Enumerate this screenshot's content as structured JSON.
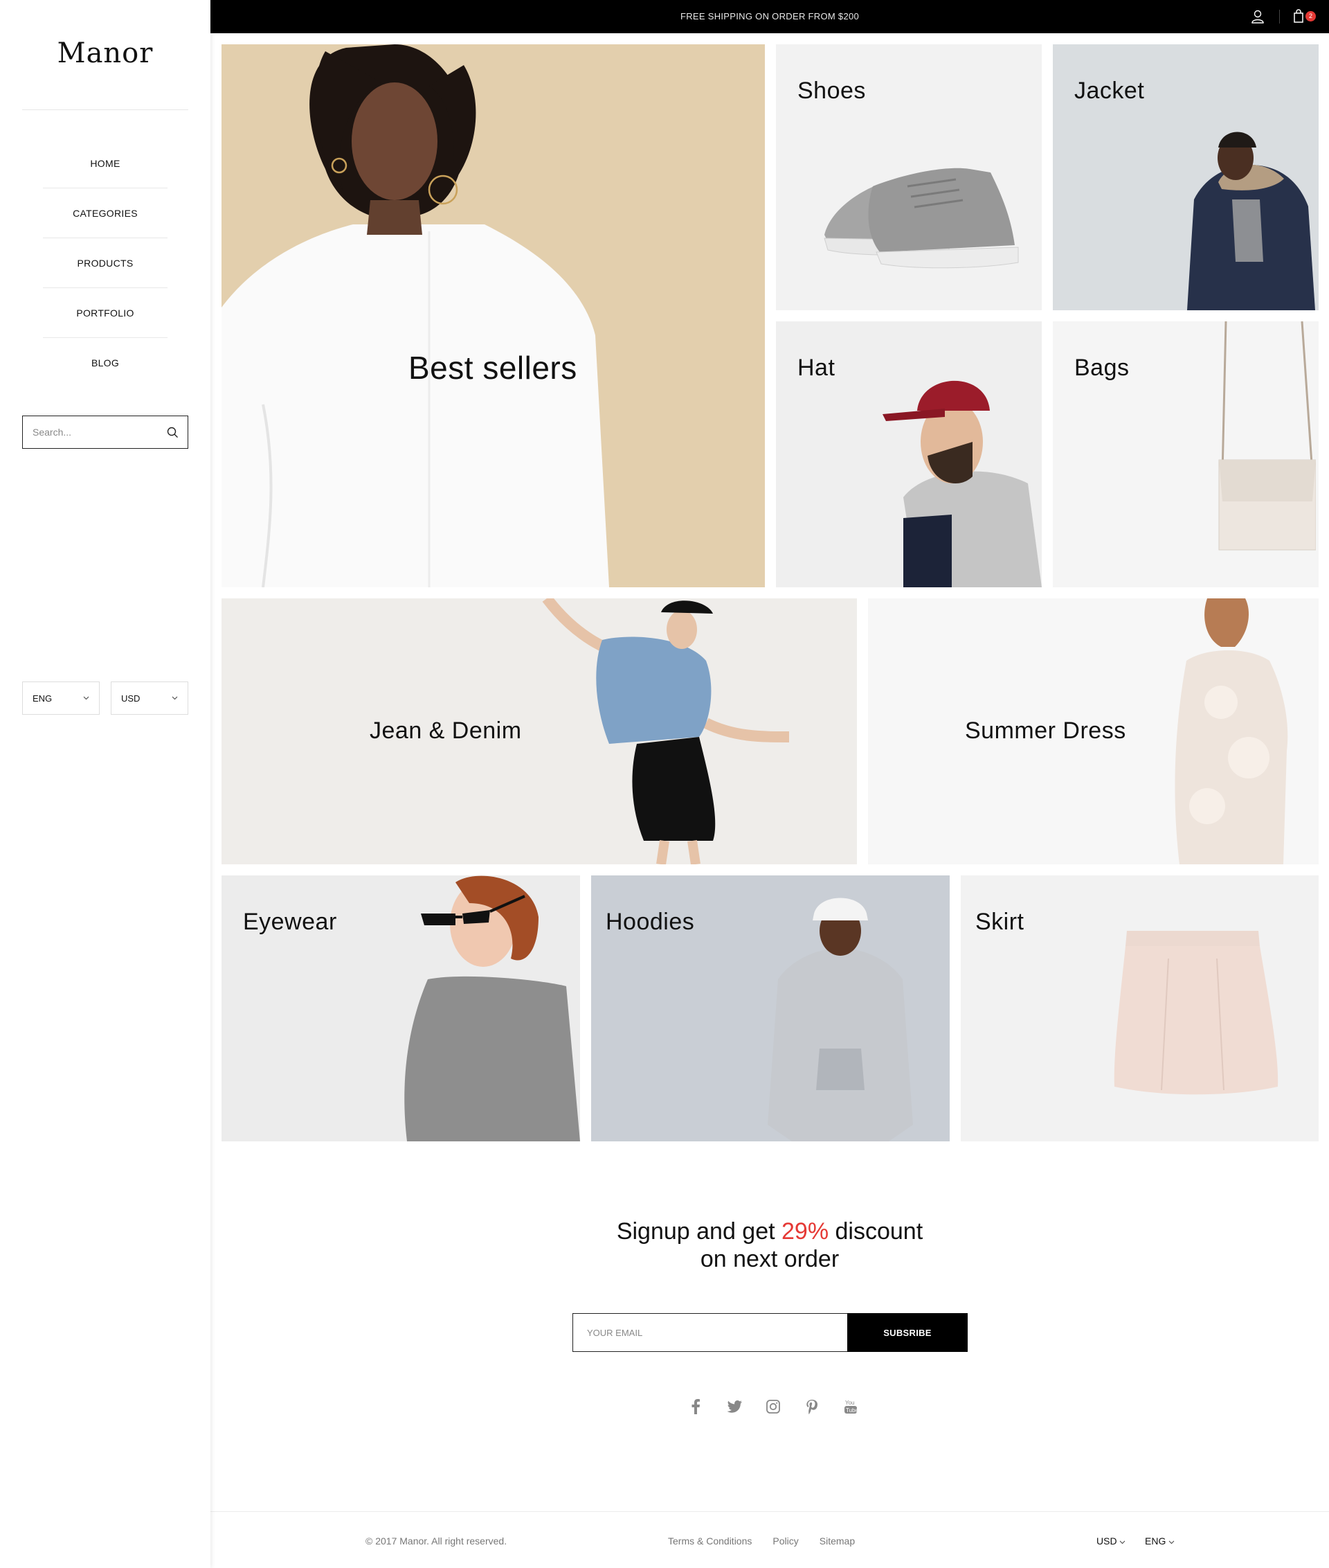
{
  "brand": {
    "logo": "Manor"
  },
  "topbar": {
    "shipping_text": "FREE SHIPPING ON ORDER FROM $200",
    "cart_count": "2"
  },
  "nav": {
    "items": [
      {
        "label": "HOME"
      },
      {
        "label": "CATEGORIES"
      },
      {
        "label": "PRODUCTS"
      },
      {
        "label": "PORTFOLIO"
      },
      {
        "label": "BLOG"
      }
    ]
  },
  "search": {
    "placeholder": "Search..."
  },
  "sidebar_selects": {
    "language": "ENG",
    "currency": "USD"
  },
  "categories": {
    "best_sellers": "Best sellers",
    "shoes": "Shoes",
    "jacket": "Jacket",
    "hat": "Hat",
    "bags": "Bags",
    "jean_denim": "Jean & Denim",
    "summer_dress": "Summer Dress",
    "eyewear": "Eyewear",
    "hoodies": "Hoodies",
    "skirt": "Skirt"
  },
  "newsletter": {
    "line1_pre": "Signup and get ",
    "discount": "29%",
    "line1_post": " discount",
    "line2": "on next order",
    "email_placeholder": "YOUR EMAIL",
    "button": "SUBSRIBE"
  },
  "social_icons": [
    "facebook-icon",
    "twitter-icon",
    "instagram-icon",
    "pinterest-icon",
    "youtube-icon"
  ],
  "footer": {
    "copyright": "© 2017 Manor. All right reserved.",
    "links": [
      "Terms & Conditions",
      "Policy",
      "Sitemap"
    ],
    "currency": "USD",
    "language": "ENG"
  },
  "colors": {
    "accent": "#e53935",
    "topbar_bg": "#000000",
    "best_sellers_bg": "#e3cfad"
  }
}
